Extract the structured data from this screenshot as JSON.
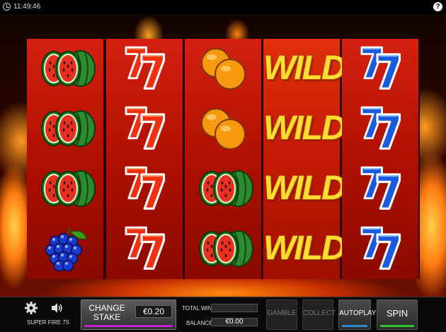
{
  "topbar": {
    "clock": "11:49:46",
    "help": "?"
  },
  "game": {
    "name": "SUPER FIRE 7S"
  },
  "reels": [
    [
      "watermelon",
      "watermelon",
      "watermelon",
      "plum"
    ],
    [
      "seven-red",
      "seven-red",
      "seven-red",
      "seven-red"
    ],
    [
      "orange",
      "orange",
      "watermelon",
      "watermelon"
    ],
    [
      "wild",
      "wild",
      "wild",
      "wild"
    ],
    [
      "seven-blue",
      "seven-blue",
      "seven-blue",
      "seven-blue"
    ]
  ],
  "wild_label": "WILD",
  "controls": {
    "change_stake_label": "CHANGE STAKE",
    "stake_value": "€0.20",
    "total_win_label": "TOTAL WIN",
    "total_win_value": "",
    "balance_label": "BALANCE",
    "balance_value": "€0.00",
    "gamble_label": "GAMBLE",
    "collect_label": "COLLECT",
    "autoplay_label": "AUTOPLAY",
    "spin_label": "SPIN"
  },
  "colors": {
    "stake_accent": "#c020d0",
    "autoplay_accent": "#2a8ad0",
    "spin_accent": "#30c030"
  }
}
